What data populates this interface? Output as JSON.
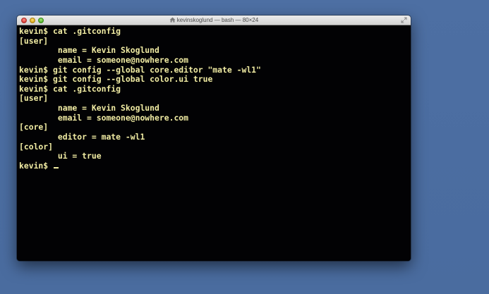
{
  "window": {
    "title": "kevinskoglund — bash — 80×24",
    "icons": {
      "title": "home-icon",
      "resize": "resize-icon"
    }
  },
  "terminal": {
    "lines": [
      "kevin$ cat .gitconfig",
      "[user]",
      "        name = Kevin Skoglund",
      "        email = someone@nowhere.com",
      "kevin$ git config --global core.editor \"mate -wl1\"",
      "kevin$ git config --global color.ui true",
      "kevin$ cat .gitconfig",
      "[user]",
      "        name = Kevin Skoglund",
      "        email = someone@nowhere.com",
      "[core]",
      "        editor = mate -wl1",
      "[color]",
      "        ui = true",
      "kevin$ "
    ],
    "text_color": "#f1eca3",
    "background_color": "#020204"
  }
}
